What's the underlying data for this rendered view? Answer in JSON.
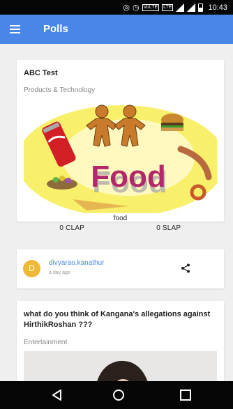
{
  "status_bar": {
    "time": "10:43",
    "icons": [
      "nfc-icon",
      "alarm-icon",
      "volte-icon",
      "lte-icon",
      "signal-icon",
      "battery-icon"
    ],
    "volte_label": "VoLTE",
    "lte_label": "LTE"
  },
  "app_bar": {
    "title": "Polls",
    "background": "#4a86e8"
  },
  "polls": [
    {
      "title": "ABC Test",
      "category": "Products & Technology",
      "image_caption": "Food",
      "option_label": "food",
      "clap_label": "0 CLAP",
      "slap_label": "0 SLAP",
      "author": {
        "avatar_letter": "D",
        "name": "divyarao.kanathur",
        "posted": "a day ago"
      }
    },
    {
      "title": "what do you think of Kangana's allegations against HirthikRoshan ???",
      "category": "Entertainment"
    }
  ],
  "colors": {
    "accent": "#4a86e8",
    "avatar": "#f0b83a",
    "background": "#efefef"
  },
  "nav_bar": {
    "icons": [
      "back-icon",
      "home-icon",
      "recents-icon"
    ]
  }
}
